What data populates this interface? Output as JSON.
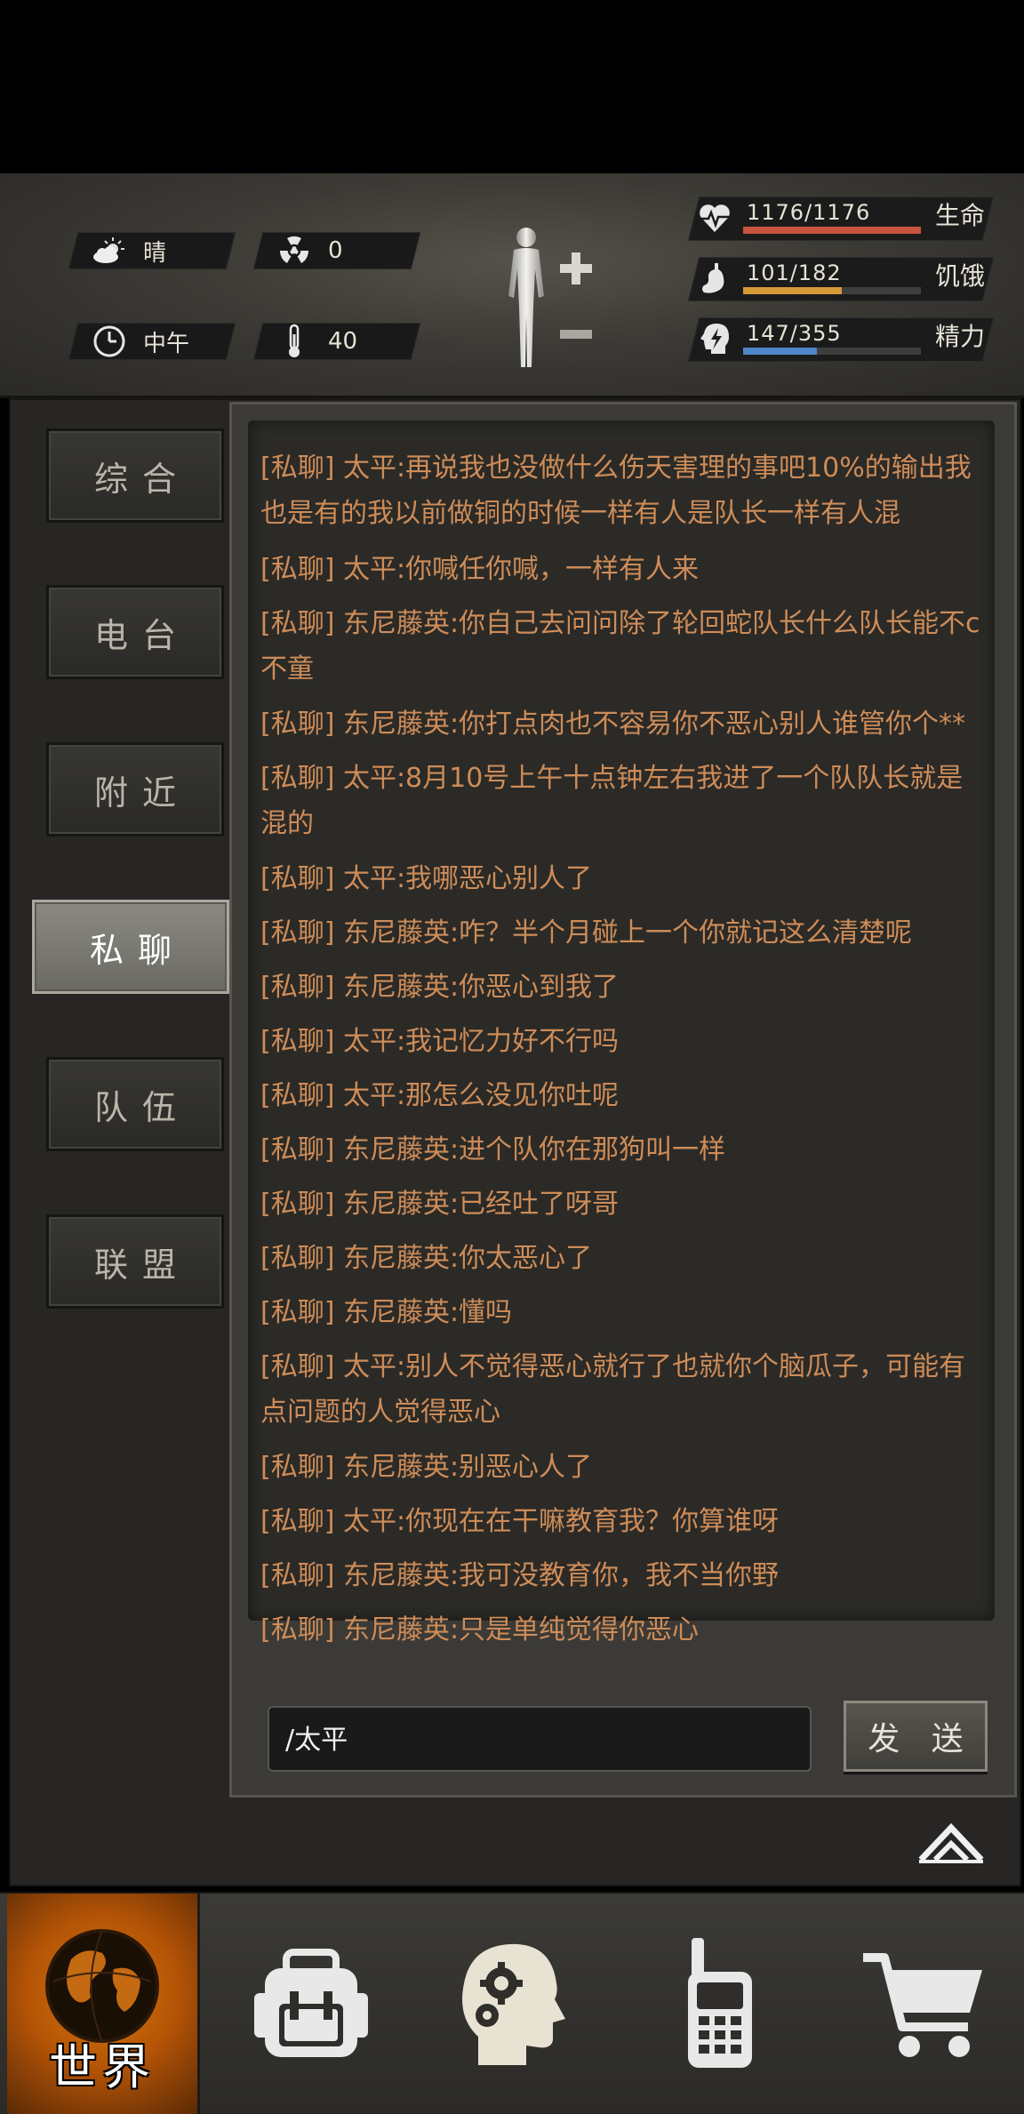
{
  "weather": {
    "label": "晴",
    "icon": "sun-cloud-icon"
  },
  "radiation": {
    "value": "0",
    "icon": "radiation-icon"
  },
  "time_of_day": {
    "label": "中午",
    "icon": "clock-icon"
  },
  "temperature": {
    "value": "40",
    "icon": "thermometer-icon"
  },
  "vitals": [
    {
      "label": "生命",
      "value": "1176/1176",
      "fraction": 1.0,
      "color": "#c9543e",
      "icon": "heart-pulse-icon"
    },
    {
      "label": "饥饿",
      "value": "101/182",
      "fraction": 0.555,
      "color": "#d69a36",
      "icon": "stomach-icon"
    },
    {
      "label": "精力",
      "value": "147/355",
      "fraction": 0.414,
      "color": "#4d86c6",
      "icon": "energy-head-icon"
    }
  ],
  "tabs": [
    {
      "label": "综合",
      "active": false
    },
    {
      "label": "电台",
      "active": false
    },
    {
      "label": "附近",
      "active": false
    },
    {
      "label": "私聊",
      "active": true
    },
    {
      "label": "队伍",
      "active": false
    },
    {
      "label": "联盟",
      "active": false
    }
  ],
  "messages": [
    "[私聊] 太平:再说我也没做什么伤天害理的事吧10%的输出我也是有的我以前做铜的时候一样有人是队长一样有人混",
    "[私聊] 太平:你喊任你喊，一样有人来",
    "[私聊] 东尼藤英:你自己去问问除了轮回蛇队长什么队长能不c不童",
    "[私聊] 东尼藤英:你打点肉也不容易你不恶心别人谁管你个**",
    "[私聊] 太平:8月10号上午十点钟左右我进了一个队队长就是混的",
    "[私聊] 太平:我哪恶心别人了",
    "[私聊] 东尼藤英:咋？半个月碰上一个你就记这么清楚呢",
    "[私聊] 东尼藤英:你恶心到我了",
    "[私聊] 太平:我记忆力好不行吗",
    "[私聊] 太平:那怎么没见你吐呢",
    "[私聊] 东尼藤英:进个队你在那狗叫一样",
    "[私聊] 东尼藤英:已经吐了呀哥",
    "[私聊] 东尼藤英:你太恶心了",
    "[私聊] 东尼藤英:懂吗",
    "[私聊] 太平:别人不觉得恶心就行了也就你个脑瓜子，可能有点问题的人觉得恶心",
    "[私聊] 东尼藤英:别恶心人了",
    "[私聊] 太平:你现在在干嘛教育我？你算谁呀",
    "[私聊] 东尼藤英:我可没教育你，我不当你野",
    "[私聊] 东尼藤英:只是单纯觉得你恶心"
  ],
  "input": {
    "value": "/太平"
  },
  "send_label": "发 送",
  "nav": [
    {
      "label": "世界",
      "icon": "globe-icon",
      "active": true
    },
    {
      "label": "",
      "icon": "backpack-icon"
    },
    {
      "label": "",
      "icon": "brain-gears-icon"
    },
    {
      "label": "",
      "icon": "walkie-talkie-icon"
    },
    {
      "label": "",
      "icon": "shopping-cart-icon"
    }
  ]
}
